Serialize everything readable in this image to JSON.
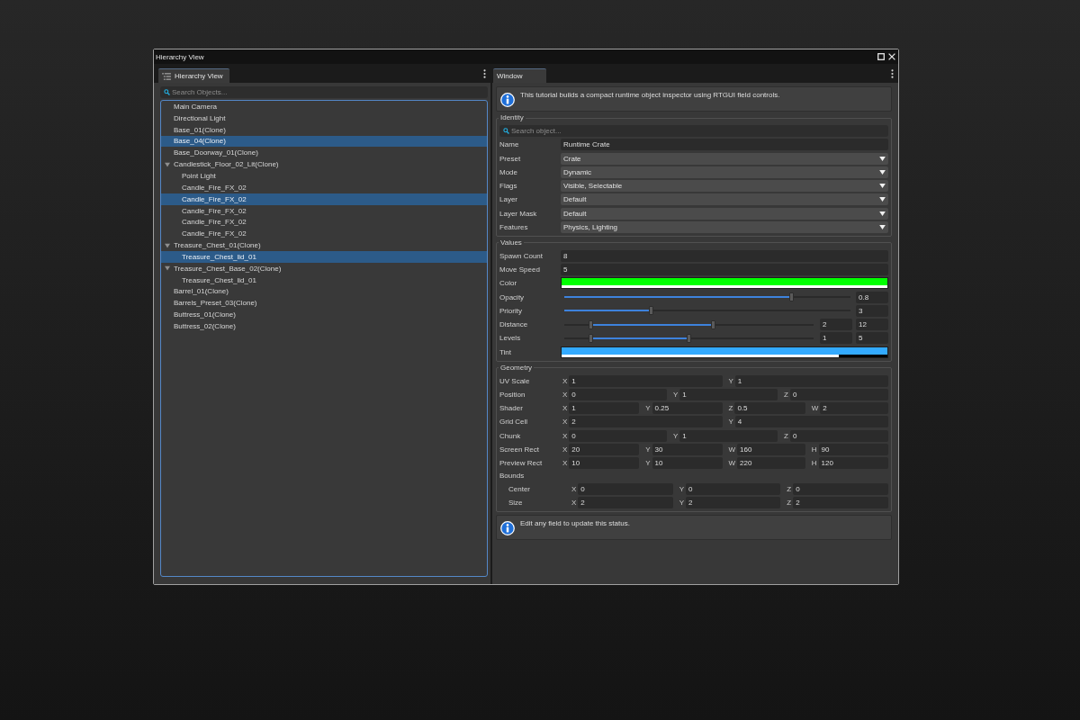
{
  "window": {
    "title": "Hierarchy View"
  },
  "hierarchy_panel": {
    "tabs": [
      {
        "label": "Hierarchy View",
        "selected": true
      }
    ],
    "search": {
      "placeholder": "Search Objects..."
    },
    "tree": [
      {
        "label": "Main Camera",
        "selected": false
      },
      {
        "label": "Directional Light",
        "selected": false
      },
      {
        "label": "Base_01(Clone)",
        "selected": false
      },
      {
        "label": "Base_04(Clone)",
        "selected": true
      },
      {
        "label": "Base_Doorway_01(Clone)",
        "selected": false
      },
      {
        "label": "Candlestick_Floor_02_Lit(Clone)",
        "selected": false,
        "expanded": true,
        "children": [
          {
            "label": "Point Light",
            "selected": false
          },
          {
            "label": "Candle_Fire_FX_02",
            "selected": false
          },
          {
            "label": "Candle_Fire_FX_02",
            "selected": true
          },
          {
            "label": "Candle_Fire_FX_02",
            "selected": false
          },
          {
            "label": "Candle_Fire_FX_02",
            "selected": false
          },
          {
            "label": "Candle_Fire_FX_02",
            "selected": false
          }
        ]
      },
      {
        "label": "Treasure_Chest_01(Clone)",
        "selected": false,
        "expanded": true,
        "children": [
          {
            "label": "Treasure_Chest_lid_01",
            "selected": true
          }
        ]
      },
      {
        "label": "Treasure_Chest_Base_02(Clone)",
        "selected": false,
        "expanded": true,
        "children": [
          {
            "label": "Treasure_Chest_lid_01",
            "selected": false
          }
        ]
      },
      {
        "label": "Barrel_01(Clone)",
        "selected": false
      },
      {
        "label": "Barrels_Preset_03(Clone)",
        "selected": false
      },
      {
        "label": "Buttress_01(Clone)",
        "selected": false
      },
      {
        "label": "Buttress_02(Clone)",
        "selected": false
      }
    ]
  },
  "inspector_panel": {
    "tabs": [
      {
        "label": "Window",
        "selected": true
      }
    ],
    "info": "This tutorial builds a compact runtime object inspector using RTGUI field controls.",
    "groups": [
      {
        "title": "Identity",
        "rows": [
          {
            "kind": "search",
            "placeholder": "Search object..."
          },
          {
            "kind": "text",
            "label": "Name",
            "value": "Runtime Crate"
          },
          {
            "kind": "dropdown",
            "label": "Preset",
            "value": "Crate"
          },
          {
            "kind": "dropdown",
            "label": "Mode",
            "value": "Dynamic"
          },
          {
            "kind": "dropdown",
            "label": "Flags",
            "value": "Visible, Selectable"
          },
          {
            "kind": "dropdown",
            "label": "Layer",
            "value": "Default"
          },
          {
            "kind": "dropdown",
            "label": "Layer Mask",
            "value": "Default"
          },
          {
            "kind": "dropdown",
            "label": "Features",
            "value": "Physics, Lighting"
          }
        ]
      },
      {
        "title": "Values",
        "rows": [
          {
            "kind": "number",
            "label": "Spawn Count",
            "value": "8"
          },
          {
            "kind": "number",
            "label": "Move Speed",
            "value": "5"
          },
          {
            "kind": "color",
            "label": "Color",
            "color": "#00ff00",
            "level": 1
          },
          {
            "kind": "slider",
            "label": "Opacity",
            "level": 0.8,
            "value": "0.8"
          },
          {
            "kind": "slider",
            "label": "Priority",
            "level": 0.3,
            "value": "3"
          },
          {
            "kind": "range",
            "label": "Distance",
            "handles": [
              {
                "level": 0.1,
                "value": "2"
              },
              {
                "level": 0.6,
                "value": "12"
              }
            ]
          },
          {
            "kind": "range",
            "label": "Levels",
            "handles": [
              {
                "level": 0.1,
                "value": "1"
              },
              {
                "level": 0.5,
                "value": "5"
              }
            ]
          },
          {
            "kind": "color",
            "label": "Tint",
            "color": "#33aaff",
            "level": 0.85
          }
        ]
      },
      {
        "title": "Geometry",
        "rows": [
          {
            "kind": "vector",
            "label": "UV Scale",
            "components": [
              {
                "axis": "X",
                "value": "1"
              },
              {
                "axis": "Y",
                "value": "1"
              }
            ]
          },
          {
            "kind": "vector",
            "label": "Position",
            "components": [
              {
                "axis": "X",
                "value": "0"
              },
              {
                "axis": "Y",
                "value": "1"
              },
              {
                "axis": "Z",
                "value": "0"
              }
            ]
          },
          {
            "kind": "vector",
            "label": "Shader",
            "components": [
              {
                "axis": "X",
                "value": "1"
              },
              {
                "axis": "Y",
                "value": "0.25"
              },
              {
                "axis": "Z",
                "value": "0.5"
              },
              {
                "axis": "W",
                "value": "2"
              }
            ]
          },
          {
            "kind": "vector",
            "label": "Grid Cell",
            "components": [
              {
                "axis": "X",
                "value": "2"
              },
              {
                "axis": "Y",
                "value": "4"
              }
            ]
          },
          {
            "kind": "vector",
            "label": "Chunk",
            "components": [
              {
                "axis": "X",
                "value": "0"
              },
              {
                "axis": "Y",
                "value": "1"
              },
              {
                "axis": "Z",
                "value": "0"
              }
            ]
          },
          {
            "kind": "vector",
            "label": "Screen Rect",
            "components": [
              {
                "axis": "X",
                "value": "20"
              },
              {
                "axis": "Y",
                "value": "30"
              },
              {
                "axis": "W",
                "value": "160"
              },
              {
                "axis": "H",
                "value": "90"
              }
            ]
          },
          {
            "kind": "vector",
            "label": "Preview Rect",
            "components": [
              {
                "axis": "X",
                "value": "10"
              },
              {
                "axis": "Y",
                "value": "10"
              },
              {
                "axis": "W",
                "value": "220"
              },
              {
                "axis": "H",
                "value": "120"
              }
            ]
          },
          {
            "kind": "group",
            "label": "Bounds",
            "rows": [
              {
                "kind": "vector",
                "label": "Center",
                "components": [
                  {
                    "axis": "X",
                    "value": "0"
                  },
                  {
                    "axis": "Y",
                    "value": "0"
                  },
                  {
                    "axis": "Z",
                    "value": "0"
                  }
                ]
              },
              {
                "kind": "vector",
                "label": "Size",
                "components": [
                  {
                    "axis": "X",
                    "value": "2"
                  },
                  {
                    "axis": "Y",
                    "value": "2"
                  },
                  {
                    "axis": "Z",
                    "value": "2"
                  }
                ]
              }
            ]
          }
        ]
      }
    ],
    "status": "Edit any field to update this status."
  }
}
